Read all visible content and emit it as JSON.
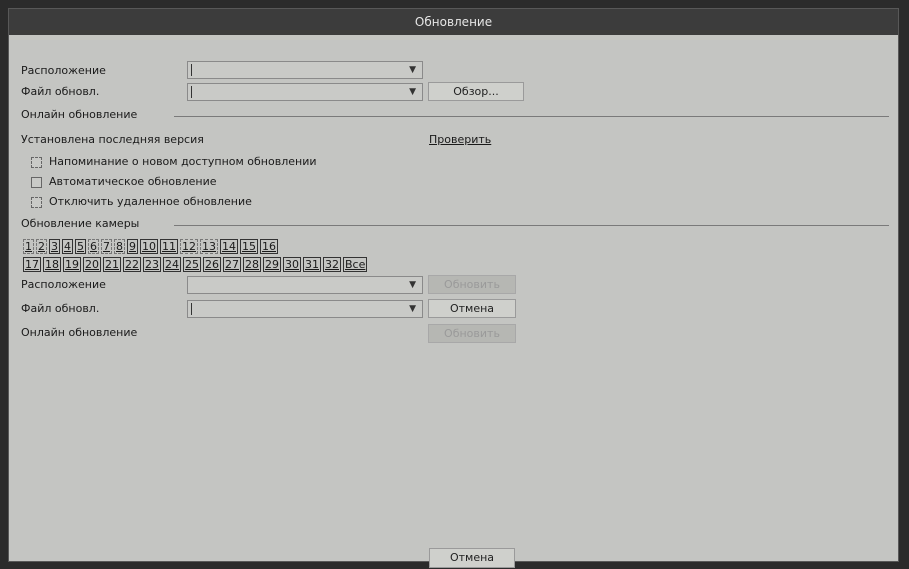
{
  "window": {
    "title": "Обновление"
  },
  "top": {
    "location_label": "Расположение",
    "location_value": "",
    "firmware_label": "Файл обновл.",
    "firmware_value": "",
    "browse_label": "Обзор..."
  },
  "device_update": {
    "section_title": "Онлайн обновление",
    "latest_version_label": "Установлена последняя версия",
    "check_label": "Проверить",
    "options": [
      {
        "label": "Напоминание о новом доступном обновлении",
        "checked": false
      },
      {
        "label": "Автоматическое обновление",
        "checked": false
      },
      {
        "label": "Отключить удаленное обновление",
        "checked": false
      }
    ]
  },
  "camera_update": {
    "section_title": "Обновление камеры",
    "channels_row1": [
      "1",
      "2",
      "3",
      "4",
      "5",
      "6",
      "7",
      "8",
      "9",
      "10",
      "11",
      "12",
      "13",
      "14",
      "15",
      "16"
    ],
    "channels_row2": [
      "17",
      "18",
      "19",
      "20",
      "21",
      "22",
      "23",
      "24",
      "25",
      "26",
      "27",
      "28",
      "29",
      "30",
      "31",
      "32",
      "Все"
    ],
    "location_label": "Расположение",
    "location_value": "",
    "refresh_label": "Обновить",
    "firmware_label": "Файл обновл.",
    "firmware_value": "",
    "browse_label": "Отмена",
    "status_label": "Онлайн обновление",
    "update_label": "Обновить"
  },
  "footer": {
    "close_label": "Отмена"
  }
}
